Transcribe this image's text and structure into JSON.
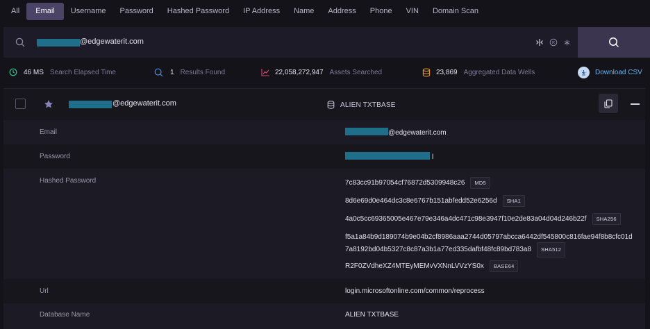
{
  "tabs": [
    "All",
    "Email",
    "Username",
    "Password",
    "Hashed Password",
    "IP Address",
    "Name",
    "Address",
    "Phone",
    "VIN",
    "Domain Scan"
  ],
  "search": {
    "value": "@edgewaterit.com",
    "tool_icons": [
      "split-icon",
      "registered-icon",
      "asterisk-icon"
    ]
  },
  "stats": {
    "elapsed_value": "46 MS",
    "elapsed_label": "Search Elapsed Time",
    "results_value": "1",
    "results_label": "Results Found",
    "assets_value": "22,058,272,947",
    "assets_label": "Assets Searched",
    "wells_value": "23,869",
    "wells_label": "Aggregated Data Wells",
    "download_label": "Download CSV"
  },
  "result": {
    "email": "@edgewaterit.com",
    "database": "ALIEN TXTBASE",
    "fields": {
      "email_key": "Email",
      "email_value": "@edgewaterit.com",
      "password_key": "Password",
      "password_suffix": "l",
      "hashed_key": "Hashed Password",
      "url_key": "Url",
      "url_value": "login.microsoftonline.com/common/reprocess",
      "dbname_key": "Database Name",
      "dbname_value": "ALIEN TXTBASE"
    },
    "hashes": {
      "md5": "7c83cc91b97054cf76872d5309948c26",
      "md5_label": "MD5",
      "sha1": "8d6e69d0e464dc3c8e6767b151abfedd52e6256d",
      "sha1_label": "SHA1",
      "sha256": "4a0c5cc69365005e467e79e346a4dc471c98e3947f10e2de83a04d04d246b22f",
      "sha256_label": "SHA256",
      "sha512_line1": "f5a1a84b9d189074b9e04b2cf8986aaa2744d05797abcca6442df545800c816fae94f8b8cfc01d",
      "sha512_line2": "7a8192bd04b5327c8c87a3b1a77ed335dafbf48fc89bd783a8",
      "sha512_label": "SHA512",
      "base64": "R2F0ZVdheXZ4MTEyMEMvVXNnLVVzYS0x",
      "base64_label": "BASE64"
    }
  },
  "colors": {
    "accent_tab": "#4b4467",
    "redaction": "#1f6f8a",
    "link": "#6ab3f0"
  }
}
